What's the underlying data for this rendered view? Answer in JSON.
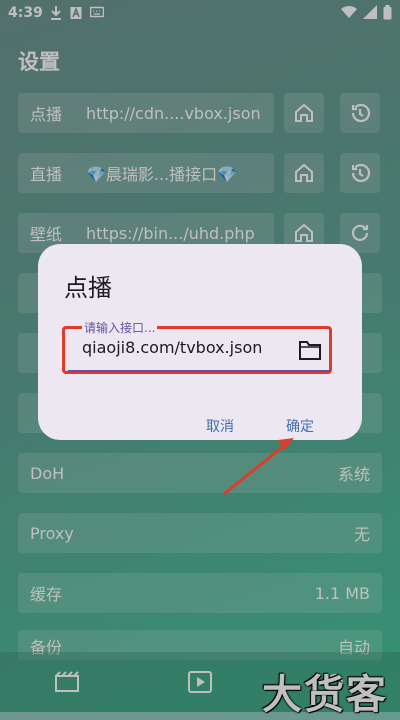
{
  "status": {
    "time": "4:39"
  },
  "page": {
    "title": "设置"
  },
  "settings": [
    {
      "label": "点播",
      "value": "http://cdn....vbox.json"
    },
    {
      "label": "直播",
      "value": "💎晨瑞影...播接口💎"
    },
    {
      "label": "壁纸",
      "value": "https://bin.../uhd.php"
    },
    {
      "label": "DoH",
      "value": "系统"
    },
    {
      "label": "Proxy",
      "value": "无"
    },
    {
      "label": "缓存",
      "value": "1.1 MB"
    },
    {
      "label": "备份",
      "value": "自动"
    }
  ],
  "dialog": {
    "title": "点播",
    "field_label": "请输入接口...",
    "field_value": "qiaoji8.com/tvbox.json",
    "cancel": "取消",
    "confirm": "确定"
  },
  "watermark": "大货客",
  "colors": {
    "highlight": "#e03a2a",
    "accent": "#6750a4",
    "button": "#3f6fb0"
  }
}
